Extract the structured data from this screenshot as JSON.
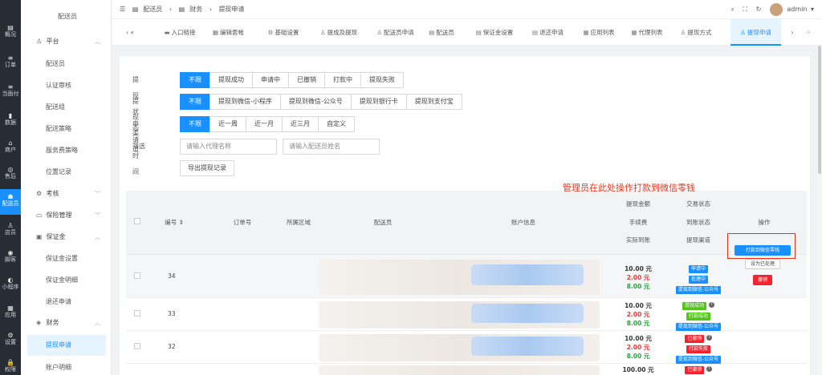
{
  "rail": [
    {
      "label": "概况",
      "icon": "▤"
    },
    {
      "label": "订单",
      "icon": "≡"
    },
    {
      "label": "当面付",
      "icon": "≡"
    },
    {
      "label": "数据",
      "icon": "▮"
    },
    {
      "label": "商户",
      "icon": "⌂"
    },
    {
      "label": "售后",
      "icon": "◎"
    },
    {
      "label": "配送员",
      "icon": "☗"
    },
    {
      "label": "店员",
      "icon": "♙"
    },
    {
      "label": "脚客",
      "icon": "◉"
    },
    {
      "label": "小程序",
      "icon": "◐"
    },
    {
      "label": "应用",
      "icon": "▦"
    },
    {
      "label": "设置",
      "icon": "⚙"
    },
    {
      "label": "权限",
      "icon": "🔒"
    }
  ],
  "sidebar": {
    "top_item": "配送员",
    "groups": {
      "platform": "平台",
      "assess": "考核",
      "insurance": "保险管理",
      "deposit": "保证金",
      "finance": "财务"
    },
    "platform_items": [
      "配送员",
      "认证审核",
      "配送组",
      "配送策略",
      "服务费策略",
      "位置记录"
    ],
    "deposit_items": [
      "保证金设置",
      "保证金明细",
      "退还申请"
    ],
    "finance_items": [
      "提现申请",
      "账户明细"
    ]
  },
  "header": {
    "breadcrumb": [
      "配送员",
      "财务",
      "提现申请"
    ],
    "user": "admin"
  },
  "tabs": [
    "入口链接",
    "编辑套帐",
    "基础设置",
    "提成及提现",
    "配送员申请",
    "配送员",
    "保证金设置",
    "退还申请",
    "应用列表",
    "代理列表",
    "提现方式",
    "提现申请"
  ],
  "filters": {
    "status_label": "提现状态",
    "status_options": [
      "不限",
      "提现成功",
      "申请中",
      "已撤销",
      "打款中",
      "提现失败"
    ],
    "channel_label": "提现渠道",
    "channel_options": [
      "不限",
      "提现到微信-小程序",
      "提现到微信-公众号",
      "提现到银行卡",
      "提现到支付宝"
    ],
    "time_label": "申请时间",
    "time_options": [
      "不限",
      "近一周",
      "近一月",
      "近三月",
      "自定义"
    ],
    "filter_label": "筛选",
    "agent_placeholder": "请输入代理名称",
    "courier_placeholder": "请输入配送员姓名",
    "export_button": "导出提现记录"
  },
  "annotation": "管理员在此处操作打款到微信零钱",
  "table": {
    "headers": {
      "id": "编号",
      "order": "订单号",
      "region": "所属区域",
      "courier": "配送员",
      "account": "账户信息",
      "amount_group": "提现金额",
      "fee": "手续费",
      "actual": "实际到账",
      "status_group": "交易状态",
      "arrival": "到账状态",
      "channel": "提现渠道",
      "action": "操作"
    },
    "rows": [
      {
        "id": "34",
        "amount": "10.00 元",
        "fee": "2.00 元",
        "actual": "8.00 元",
        "tags": [
          "申请中",
          "处理中",
          "提现到微信-公众号"
        ],
        "tag_colors": [
          "blue",
          "blue",
          "blue"
        ],
        "actions": [
          "打款到微信零钱",
          "设为已处理",
          "撤销"
        ]
      },
      {
        "id": "33",
        "amount": "10.00 元",
        "fee": "2.00 元",
        "actual": "8.00 元",
        "tags": [
          "提现成功",
          "打款成功",
          "提现到微信-公众号"
        ],
        "tag_colors": [
          "green",
          "green",
          "blue"
        ],
        "actions": []
      },
      {
        "id": "32",
        "amount": "10.00 元",
        "fee": "2.00 元",
        "actual": "8.00 元",
        "tags": [
          "已撤销",
          "打款失败",
          "提现到微信-公众号"
        ],
        "tag_colors": [
          "red",
          "red",
          "blue"
        ],
        "actions": []
      },
      {
        "id": "",
        "amount": "100.00 元",
        "fee": "",
        "actual": "",
        "tags": [
          "已撤销"
        ],
        "tag_colors": [
          "red"
        ],
        "actions": []
      }
    ]
  }
}
